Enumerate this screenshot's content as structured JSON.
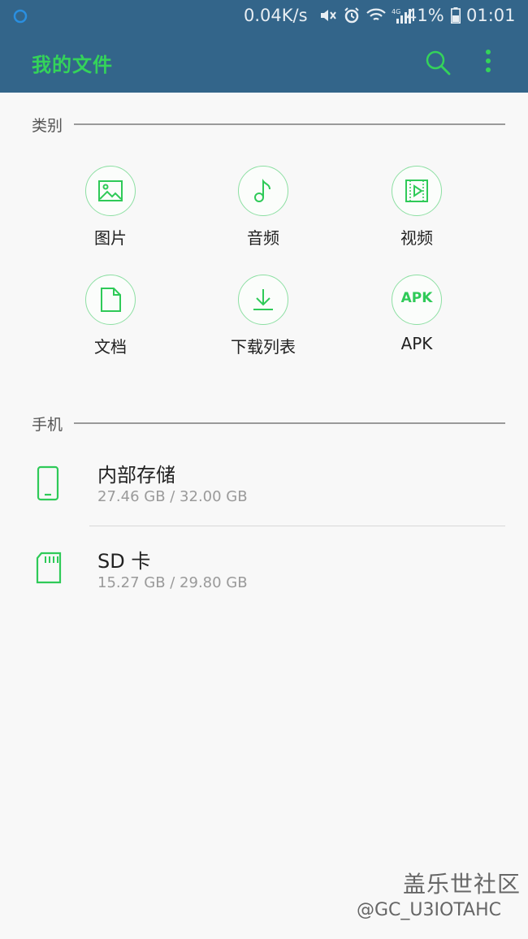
{
  "status_bar": {
    "speed": "0.04K/s",
    "battery": "41%",
    "time": "01:01",
    "icons": [
      "assistant-icon",
      "mute-icon",
      "alarm-icon",
      "wifi-icon",
      "signal-4g-icon",
      "battery-icon"
    ]
  },
  "app_bar": {
    "title": "我的文件",
    "accent_color": "#34d35a",
    "background_color": "#33658a"
  },
  "categories_section": {
    "header": "类别",
    "items": [
      {
        "label": "图片",
        "icon": "image-icon"
      },
      {
        "label": "音频",
        "icon": "music-note-icon"
      },
      {
        "label": "视频",
        "icon": "video-icon"
      },
      {
        "label": "文档",
        "icon": "document-icon"
      },
      {
        "label": "下载列表",
        "icon": "download-icon"
      },
      {
        "label": "APK",
        "icon": "apk-icon",
        "icon_text": "APK"
      }
    ]
  },
  "phone_section": {
    "header": "手机",
    "storage": [
      {
        "name": "内部存储",
        "size": "27.46 GB / 32.00 GB",
        "icon": "phone-icon"
      },
      {
        "name": "SD 卡",
        "size": "15.27 GB / 29.80 GB",
        "icon": "sd-card-icon"
      }
    ]
  },
  "watermark": {
    "title": "盖乐世社区",
    "user": "@GC_U3IOTAHC"
  }
}
